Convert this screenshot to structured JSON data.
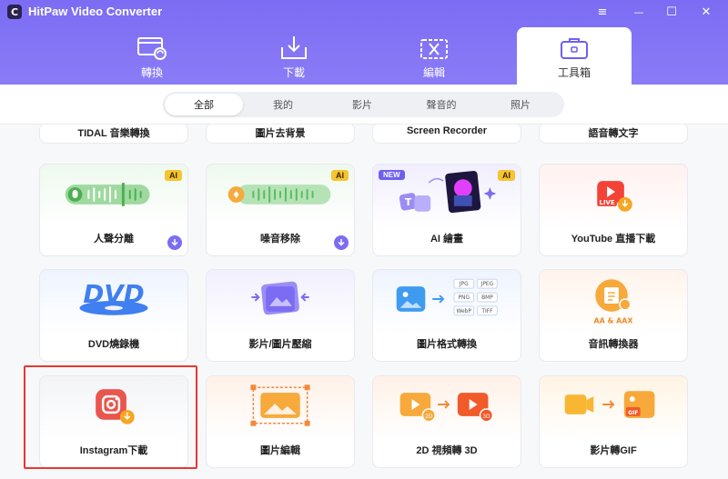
{
  "app": {
    "title": "HitPaw Video Converter",
    "logo_letter": "C"
  },
  "window_controls": {
    "menu": "≡",
    "minimize": "—",
    "maximize": "☐",
    "close": "✕"
  },
  "nav_tabs": [
    {
      "label": "轉換",
      "icon": "convert-icon",
      "active": false
    },
    {
      "label": "下載",
      "icon": "download-icon",
      "active": false
    },
    {
      "label": "編輯",
      "icon": "edit-icon",
      "active": false
    },
    {
      "label": "工具箱",
      "icon": "toolbox-icon",
      "active": true
    }
  ],
  "filters": [
    {
      "label": "全部",
      "active": true
    },
    {
      "label": "我的",
      "active": false
    },
    {
      "label": "影片",
      "active": false
    },
    {
      "label": "聲音的",
      "active": false
    },
    {
      "label": "照片",
      "active": false
    }
  ],
  "tools_row0": [
    {
      "name": "TIDAL 音樂轉換"
    },
    {
      "name": "圖片去背景"
    },
    {
      "name": "Screen Recorder"
    },
    {
      "name": "語音轉文字"
    }
  ],
  "tools_row1": [
    {
      "name": "人聲分離",
      "badge": "AI",
      "icon": "voice-separation-icon",
      "downloadable": true
    },
    {
      "name": "噪音移除",
      "badge": "AI",
      "icon": "noise-removal-icon",
      "downloadable": true
    },
    {
      "name": "AI 繪畫",
      "badge": "AI",
      "new_badge": "NEW",
      "icon": "ai-painting-icon",
      "downloadable": false
    },
    {
      "name": "YouTube 直播下載",
      "icon": "youtube-live-icon",
      "live_label": "LIVE",
      "downloadable": false
    }
  ],
  "tools_row2": [
    {
      "name": "DVD燒錄機",
      "icon": "dvd-icon",
      "dvd_text": "DVD"
    },
    {
      "name": "影片/圖片壓縮",
      "icon": "compress-icon"
    },
    {
      "name": "圖片格式轉換",
      "icon": "image-format-icon",
      "formats": [
        "JPG",
        "JPEG",
        "PNG",
        "BMP",
        "WebP",
        "TIFF"
      ]
    },
    {
      "name": "音訊轉換器",
      "icon": "audio-converter-icon",
      "format_text": "AA & AAX"
    }
  ],
  "tools_row3": [
    {
      "name": "Instagram下載",
      "icon": "instagram-icon",
      "highlighted": true
    },
    {
      "name": "圖片編輯",
      "icon": "image-edit-icon"
    },
    {
      "name": "2D 視頻轉 3D",
      "icon": "2d-to-3d-icon",
      "from_label": "2D",
      "to_label": "3D"
    },
    {
      "name": "影片轉GIF",
      "icon": "video-to-gif-icon",
      "gif_label": "GIF"
    }
  ],
  "colors": {
    "brand": "#7b6cf3",
    "ai_badge": "#f6c431",
    "highlight": "#e53935"
  }
}
